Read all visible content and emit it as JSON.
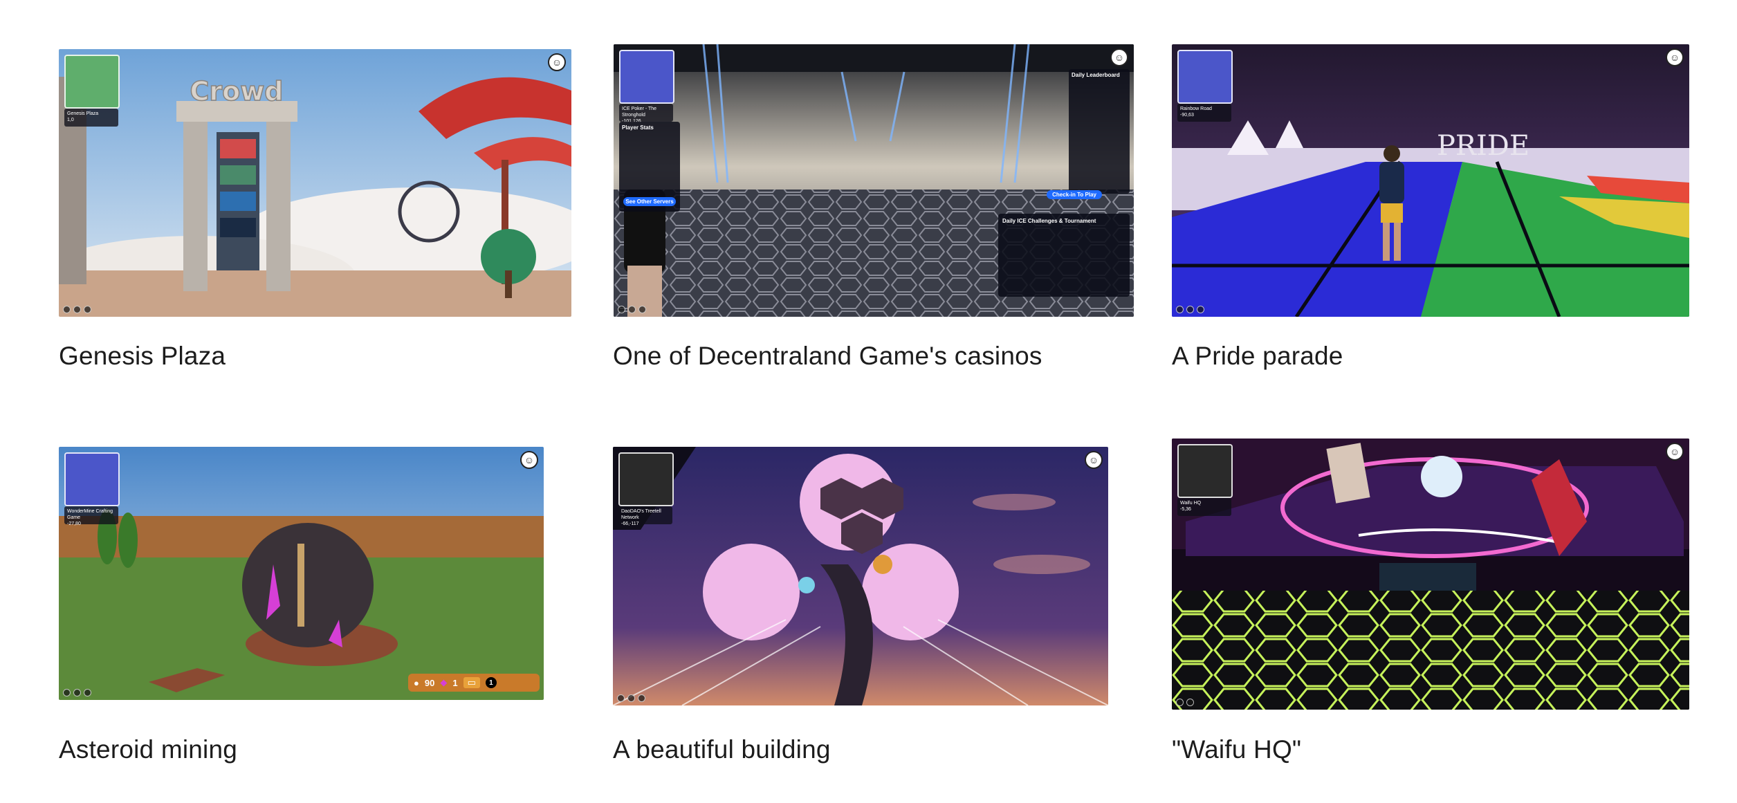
{
  "gallery": [
    {
      "caption": "Genesis Plaza",
      "hud": {
        "location_name": "Genesis Plaza",
        "coords": "1,0",
        "minimap_color": "#5fae6c"
      },
      "scene": {
        "sky_top": "#6fa3d8",
        "sky_bottom": "#d9e6f2",
        "ground": "#c9a48a",
        "accent": "#c8332e"
      },
      "sign_text": "Crowd"
    },
    {
      "caption": "One of Decentraland Game's casinos",
      "hud": {
        "location_name": "ICE Poker - The Stronghold",
        "coords": "-101,126",
        "minimap_color": "#4b56c9"
      },
      "scene": {
        "sky_top": "#1a1d24",
        "sky_bottom": "#c9c3b6",
        "ground": "#3a3d48",
        "accent": "#1f6bff"
      },
      "panel_titles": [
        "Daily Leaderboard",
        "Player Stats",
        "Daily ICE Challenges & Tournament",
        "See Other Servers",
        "Check-in To Play"
      ]
    },
    {
      "caption": "A Pride parade",
      "hud": {
        "location_name": "Rainbow Road",
        "coords": "-90,63",
        "minimap_color": "#4b56c9"
      },
      "scene": {
        "sky_top": "#2a1f3f",
        "sky_bottom": "#5b3b78",
        "ground": "#2b2bd6",
        "accent": "#2fa84a"
      },
      "sign_text": "PRIDE"
    },
    {
      "caption": "Asteroid mining",
      "hud": {
        "location_name": "WonderMine Crafting Game",
        "coords": "-27,80",
        "minimap_color": "#4b56c9"
      },
      "scene": {
        "sky_top": "#4a86c8",
        "sky_bottom": "#cfe2f2",
        "ground": "#5c8a3a",
        "accent": "#d63fd6"
      },
      "resources": [
        "90",
        "1",
        "1"
      ]
    },
    {
      "caption": "A beautiful building",
      "hud": {
        "location_name": "DaoDAO's Treetell Network",
        "coords": "-66,-117",
        "minimap_color": "#2a2a2a"
      },
      "scene": {
        "sky_top": "#2b2766",
        "sky_bottom": "#d08a6a",
        "ground": "#1e1a3a",
        "accent": "#f08ae8"
      }
    },
    {
      "caption": "\"Waifu HQ\"",
      "hud": {
        "location_name": "Waifu HQ",
        "coords": "-5,36",
        "minimap_color": "#2a2a2a"
      },
      "scene": {
        "sky_top": "#2a1030",
        "sky_bottom": "#0d0d14",
        "ground": "#0f0f12",
        "accent": "#f26ad0"
      }
    }
  ]
}
